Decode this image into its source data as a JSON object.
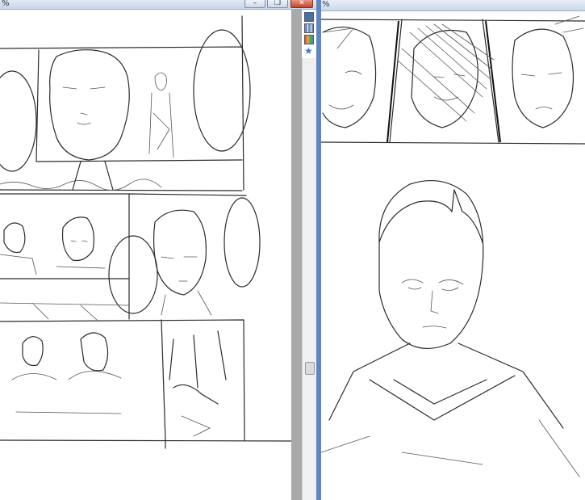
{
  "left_window": {
    "title_fragment": "%",
    "controls": {
      "minimize": "–",
      "restore": "❐",
      "close": "✕"
    }
  },
  "right_window": {
    "title_fragment": "%"
  },
  "tools": [
    {
      "icon": "layers-icon",
      "color": "#4a6fa5"
    },
    {
      "icon": "grid-icon",
      "color": "#6f8fbf"
    },
    {
      "icon": "color-palette-icon",
      "color": "#c44"
    },
    {
      "icon": "star-icon",
      "color": "#3a7bd5"
    }
  ],
  "colors": {
    "separator": "#5d87c4",
    "scrollbar": "#a9a9a9",
    "ink": "#2b2b2b"
  }
}
